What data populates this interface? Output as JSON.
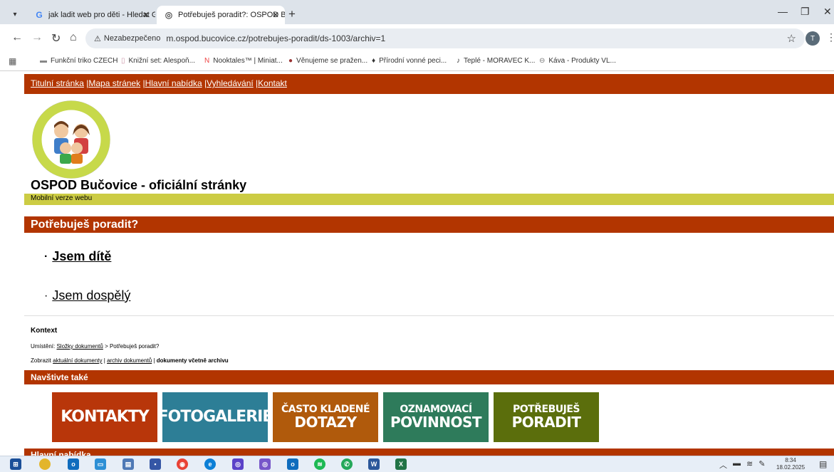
{
  "browser": {
    "tabs": [
      {
        "title": "jak ladit web pro děti - Hledat G",
        "favicon": "google-icon"
      },
      {
        "title": "Potřebuješ poradit?: OSPOD Bu",
        "favicon": "globe-icon"
      }
    ],
    "url": "m.ospod.bucovice.cz/potrebujes-poradit/ds-1003/archiv=1",
    "security_label": "Nezabezpečeno",
    "avatar_letter": "T",
    "bookmarks": [
      {
        "label": "Funkční triko CZECH"
      },
      {
        "label": "Knižní set: Alespoň..."
      },
      {
        "label": "Nooktales™ | Miniat..."
      },
      {
        "label": "Věnujeme se pražen..."
      },
      {
        "label": "Přírodní vonné peci..."
      },
      {
        "label": "Teplé - MORAVEC K..."
      },
      {
        "label": "Káva - Produkty VL..."
      }
    ]
  },
  "site": {
    "nav": [
      "Titulní stránka",
      "Mapa stránek",
      "Hlavní nabídka",
      "Vyhledávání",
      "Kontakt"
    ],
    "title": "OSPOD Bučovice - oficiální stránky",
    "mobile_label": "Mobilní verze webu",
    "section_title": "Potřebuješ poradit?",
    "items": [
      "Jsem dítě",
      "Jsem dospělý"
    ],
    "context": {
      "label": "Kontext",
      "location_prefix": "Umístění:",
      "location_link": "Složky dokumentů",
      "location_rest": "> Potřebuješ poradit?",
      "show_prefix": "Zobrazit",
      "show_link1": "aktuální dokumenty",
      "show_sep": "|",
      "show_link2": "archiv dokumentů",
      "show_current": "dokumenty včetně archivu"
    },
    "visit_title": "Navštivte také",
    "promos": [
      {
        "line1": "KONTAKTY",
        "line2": "",
        "color": "#b8360a"
      },
      {
        "line1": "FOTOGALERIE",
        "line2": "",
        "color": "#2d7e96"
      },
      {
        "line1": "ČASTO KLADENÉ",
        "line2": "DOTAZY",
        "color": "#b05a0c"
      },
      {
        "line1": "OZNAMOVACÍ",
        "line2": "POVINNOST",
        "color": "#2e7b5b"
      },
      {
        "line1": "POTŘEBUJEŠ",
        "line2": "PORADIT",
        "color": "#5b6e0c"
      }
    ],
    "bottom_title": "Hlavní nabídka"
  },
  "taskbar": {
    "time": "8:34",
    "date": "18.02.2025"
  }
}
